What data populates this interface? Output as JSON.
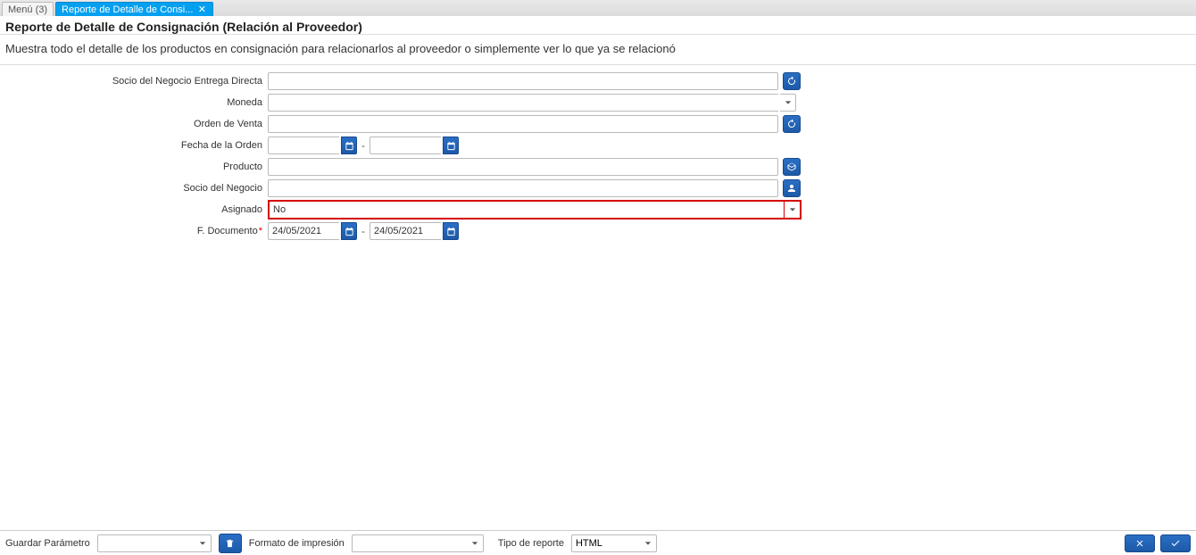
{
  "tabs": {
    "menu": "Menú (3)",
    "active": "Reporte de Detalle de Consi..."
  },
  "page": {
    "title": "Reporte de Detalle de Consignación (Relación al Proveedor)",
    "description": "Muestra todo el detalle de los productos en consignación para relacionarlos al proveedor o simplemente ver lo que ya se relacionó"
  },
  "form": {
    "socio_entrega_label": "Socio del Negocio Entrega Directa",
    "socio_entrega_value": "",
    "moneda_label": "Moneda",
    "moneda_value": "",
    "orden_venta_label": "Orden de Venta",
    "orden_venta_value": "",
    "fecha_orden_label": "Fecha de la Orden",
    "fecha_orden_from": "",
    "fecha_orden_to": "",
    "producto_label": "Producto",
    "producto_value": "",
    "socio_negocio_label": "Socio del Negocio",
    "socio_negocio_value": "",
    "asignado_label": "Asignado",
    "asignado_value": "No",
    "f_documento_label": "F. Documento",
    "f_documento_from": "24/05/2021",
    "f_documento_to": "24/05/2021"
  },
  "bottom": {
    "guardar_param_label": "Guardar Parámetro",
    "guardar_param_value": "",
    "formato_label": "Formato de impresión",
    "formato_value": "",
    "tipo_reporte_label": "Tipo de reporte",
    "tipo_reporte_value": "HTML"
  }
}
